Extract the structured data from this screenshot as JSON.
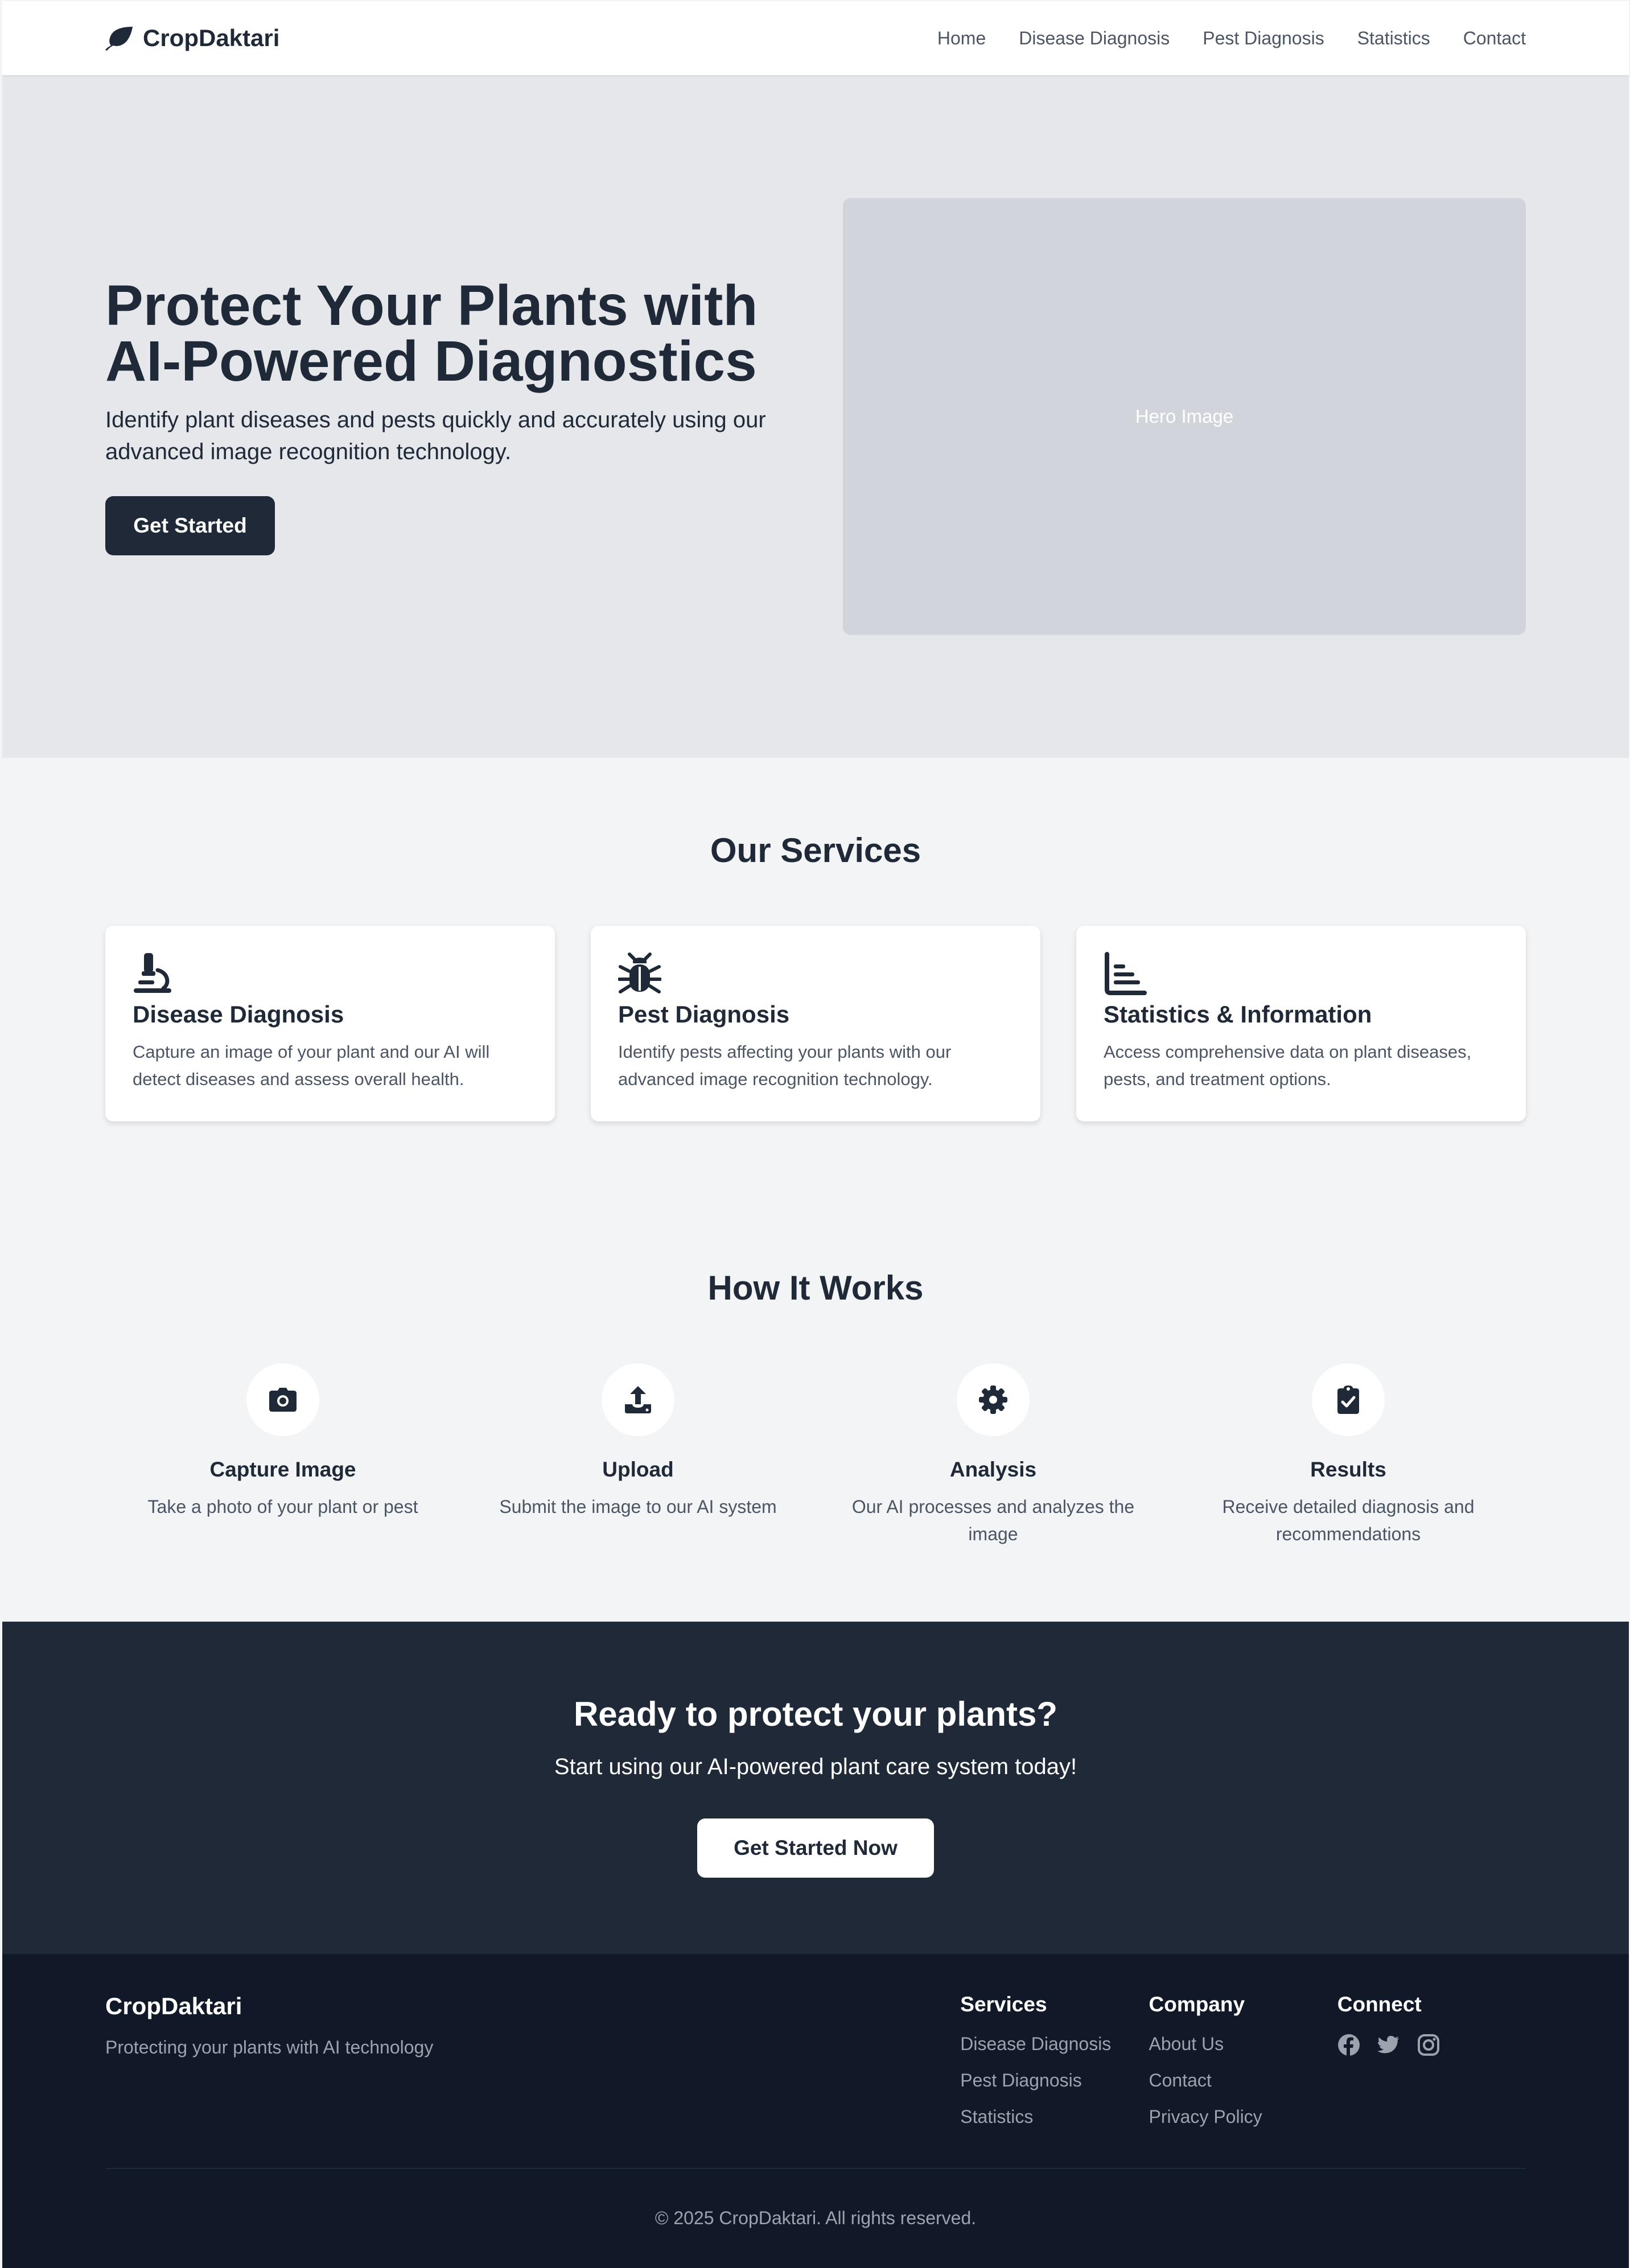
{
  "brand": {
    "name": "CropDaktari",
    "logo_icon": "leaf-icon"
  },
  "nav": {
    "links": [
      "Home",
      "Disease Diagnosis",
      "Pest Diagnosis",
      "Statistics",
      "Contact"
    ]
  },
  "hero": {
    "title_line1": "Protect Your Plants with",
    "title_line2": "AI-Powered Diagnostics",
    "subtitle": "Identify plant diseases and pests quickly and accurately using our advanced image recognition technology.",
    "cta_label": "Get Started",
    "image_placeholder": "Hero Image"
  },
  "services": {
    "title": "Our Services",
    "cards": [
      {
        "icon": "microscope-icon",
        "title": "Disease Diagnosis",
        "text": "Capture an image of your plant and our AI will detect diseases and assess overall health."
      },
      {
        "icon": "bug-icon",
        "title": "Pest Diagnosis",
        "text": "Identify pests affecting your plants with our advanced image recognition technology."
      },
      {
        "icon": "bar-chart-icon",
        "title": "Statistics & Information",
        "text": "Access comprehensive data on plant diseases, pests, and treatment options."
      }
    ]
  },
  "how": {
    "title": "How It Works",
    "steps": [
      {
        "icon": "camera-icon",
        "title": "Capture Image",
        "text": "Take a photo of your plant or pest"
      },
      {
        "icon": "upload-icon",
        "title": "Upload",
        "text": "Submit the image to our AI system"
      },
      {
        "icon": "gear-icon",
        "title": "Analysis",
        "text": "Our AI processes and analyzes the image"
      },
      {
        "icon": "clipboard-check-icon",
        "title": "Results",
        "text": "Receive detailed diagnosis and recommendations"
      }
    ]
  },
  "cta": {
    "title": "Ready to protect your plants?",
    "subtitle": "Start using our AI-powered plant care system today!",
    "button_label": "Get Started Now"
  },
  "footer": {
    "brand_name": "CropDaktari",
    "tagline": "Protecting your plants with AI technology",
    "services": {
      "title": "Services",
      "links": [
        "Disease Diagnosis",
        "Pest Diagnosis",
        "Statistics"
      ]
    },
    "company": {
      "title": "Company",
      "links": [
        "About Us",
        "Contact",
        "Privacy Policy"
      ]
    },
    "connect": {
      "title": "Connect",
      "icons": [
        "facebook-icon",
        "twitter-icon",
        "instagram-icon"
      ]
    },
    "copyright": "© 2025 CropDaktari. All rights reserved."
  },
  "colors": {
    "primary_dark": "#1f2937",
    "footer_bg": "#111827",
    "hero_bg": "#e5e7eb",
    "page_bg": "#f3f4f6",
    "muted_text": "#4b5563",
    "footer_muted": "#9ca3af"
  }
}
